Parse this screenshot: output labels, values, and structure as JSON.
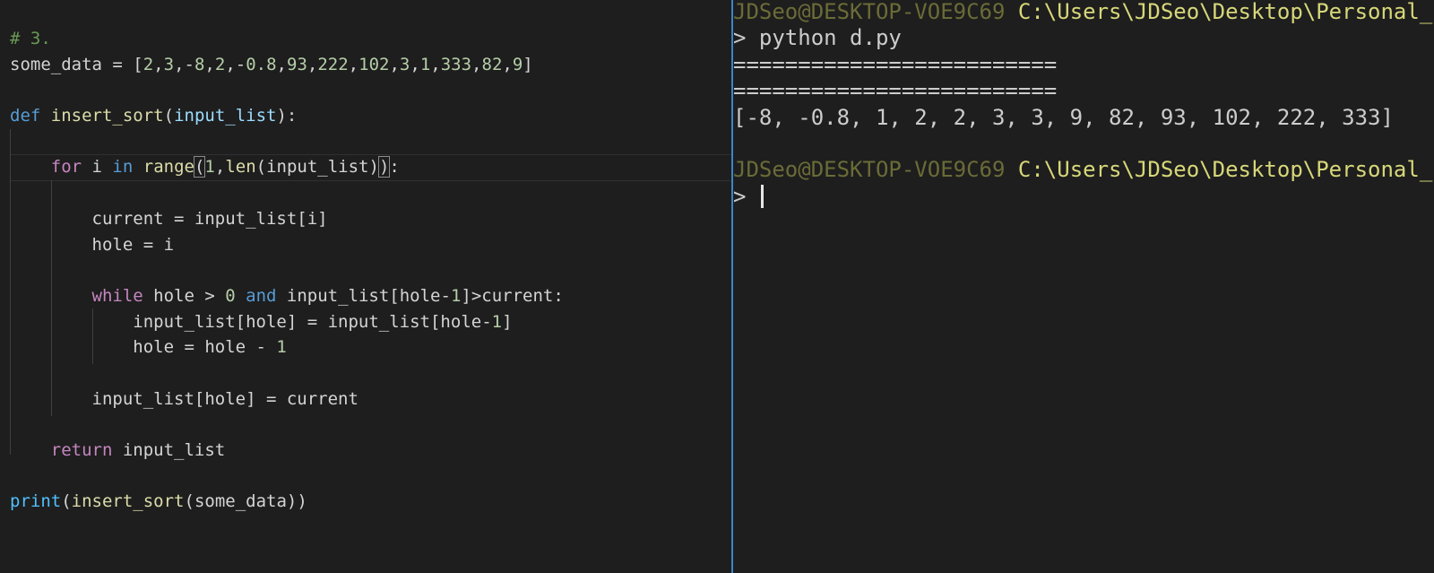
{
  "editor": {
    "lines": [
      [
        {
          "text": "# 3.",
          "c": "comment"
        }
      ],
      [
        {
          "text": "some_data = [",
          "c": "text"
        },
        {
          "text": "2",
          "c": "num"
        },
        {
          "text": ",",
          "c": "text"
        },
        {
          "text": "3",
          "c": "num"
        },
        {
          "text": ",-",
          "c": "text"
        },
        {
          "text": "8",
          "c": "num"
        },
        {
          "text": ",",
          "c": "text"
        },
        {
          "text": "2",
          "c": "num"
        },
        {
          "text": ",-",
          "c": "text"
        },
        {
          "text": "0.8",
          "c": "num"
        },
        {
          "text": ",",
          "c": "text"
        },
        {
          "text": "93",
          "c": "num"
        },
        {
          "text": ",",
          "c": "text"
        },
        {
          "text": "222",
          "c": "num"
        },
        {
          "text": ",",
          "c": "text"
        },
        {
          "text": "102",
          "c": "num"
        },
        {
          "text": ",",
          "c": "text"
        },
        {
          "text": "3",
          "c": "num"
        },
        {
          "text": ",",
          "c": "text"
        },
        {
          "text": "1",
          "c": "num"
        },
        {
          "text": ",",
          "c": "text"
        },
        {
          "text": "333",
          "c": "num"
        },
        {
          "text": ",",
          "c": "text"
        },
        {
          "text": "82",
          "c": "num"
        },
        {
          "text": ",",
          "c": "text"
        },
        {
          "text": "9",
          "c": "num"
        },
        {
          "text": "]",
          "c": "text"
        }
      ],
      [],
      [
        {
          "text": "def",
          "c": "kw"
        },
        {
          "text": " ",
          "c": "text"
        },
        {
          "text": "insert_sort",
          "c": "fn"
        },
        {
          "text": "(",
          "c": "text"
        },
        {
          "text": "input_list",
          "c": "param"
        },
        {
          "text": "):",
          "c": "text"
        }
      ],
      [],
      [
        {
          "text": "    ",
          "c": "text"
        },
        {
          "text": "for",
          "c": "ctrl"
        },
        {
          "text": " i ",
          "c": "text"
        },
        {
          "text": "in",
          "c": "kw"
        },
        {
          "text": " ",
          "c": "text"
        },
        {
          "text": "range",
          "c": "fn"
        },
        {
          "text": "(",
          "c": "text",
          "bm": true
        },
        {
          "text": "1",
          "c": "num"
        },
        {
          "text": ",",
          "c": "text"
        },
        {
          "text": "len",
          "c": "fn"
        },
        {
          "text": "(input_list)",
          "c": "text"
        },
        {
          "text": ")",
          "c": "text",
          "bm": true
        },
        {
          "text": ":",
          "c": "text"
        }
      ],
      [],
      [
        {
          "text": "        current = input_list[i]",
          "c": "text"
        }
      ],
      [
        {
          "text": "        hole = i",
          "c": "text"
        }
      ],
      [],
      [
        {
          "text": "        ",
          "c": "text"
        },
        {
          "text": "while",
          "c": "ctrl"
        },
        {
          "text": " hole > ",
          "c": "text"
        },
        {
          "text": "0",
          "c": "num"
        },
        {
          "text": " ",
          "c": "text"
        },
        {
          "text": "and",
          "c": "kw"
        },
        {
          "text": " input_list[hole-",
          "c": "text"
        },
        {
          "text": "1",
          "c": "num"
        },
        {
          "text": "]>current:",
          "c": "text"
        }
      ],
      [
        {
          "text": "            input_list[hole] = input_list[hole-",
          "c": "text"
        },
        {
          "text": "1",
          "c": "num"
        },
        {
          "text": "]",
          "c": "text"
        }
      ],
      [
        {
          "text": "            hole = hole - ",
          "c": "text"
        },
        {
          "text": "1",
          "c": "num"
        }
      ],
      [],
      [
        {
          "text": "        input_list[hole] = current",
          "c": "text"
        }
      ],
      [],
      [
        {
          "text": "    ",
          "c": "text"
        },
        {
          "text": "return",
          "c": "ctrl"
        },
        {
          "text": " input_list",
          "c": "text"
        }
      ],
      [],
      [
        {
          "text": "print",
          "c": "bi"
        },
        {
          "text": "(",
          "c": "text"
        },
        {
          "text": "insert_sort",
          "c": "fn"
        },
        {
          "text": "(some_data))",
          "c": "text"
        }
      ]
    ]
  },
  "terminal": {
    "lines": [
      [
        {
          "text": "JDSeo@DESKTOP-VOE9C69",
          "c": "user"
        },
        {
          "text": " ",
          "c": "out"
        },
        {
          "text": "C:\\Users\\JDSeo\\Desktop\\Personal_",
          "c": "path"
        }
      ],
      [
        {
          "text": "> ",
          "c": "prompt"
        },
        {
          "text": "python d.py",
          "c": "out"
        }
      ],
      [
        {
          "text": "=========================",
          "c": "out"
        }
      ],
      [
        {
          "text": "=========================",
          "c": "out"
        }
      ],
      [
        {
          "text": "[-8, -0.8, 1, 2, 2, 3, 3, 9, 82, 93, 102, 222, 333]",
          "c": "out"
        }
      ],
      [],
      [
        {
          "text": "JDSeo@DESKTOP-VOE9C69",
          "c": "user"
        },
        {
          "text": " ",
          "c": "out"
        },
        {
          "text": "C:\\Users\\JDSeo\\Desktop\\Personal_",
          "c": "path"
        }
      ],
      [
        {
          "text": "> ",
          "c": "prompt"
        },
        {
          "text": "",
          "c": "out",
          "cursor": true
        }
      ]
    ]
  }
}
